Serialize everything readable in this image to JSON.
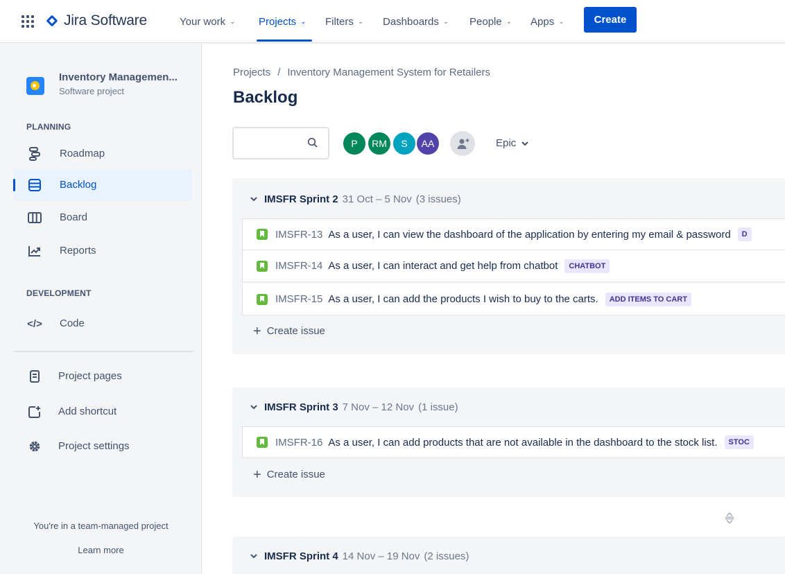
{
  "topnav": {
    "product": "Jira Software",
    "items": [
      {
        "label": "Your work"
      },
      {
        "label": "Projects"
      },
      {
        "label": "Filters"
      },
      {
        "label": "Dashboards"
      },
      {
        "label": "People"
      },
      {
        "label": "Apps"
      }
    ],
    "active_item": "Projects",
    "create_label": "Create",
    "accent": "#0052CC"
  },
  "sidebar": {
    "project_name": "Inventory Managemen...",
    "project_type": "Software project",
    "planning_label": "PLANNING",
    "planning_items": [
      {
        "label": "Roadmap",
        "icon": "roadmap-icon"
      },
      {
        "label": "Backlog",
        "icon": "backlog-icon",
        "active": true
      },
      {
        "label": "Board",
        "icon": "board-icon"
      },
      {
        "label": "Reports",
        "icon": "reports-icon"
      }
    ],
    "development_label": "DEVELOPMENT",
    "development_items": [
      {
        "label": "Code",
        "icon": "code-icon"
      }
    ],
    "other_items": [
      {
        "label": "Project pages",
        "icon": "page-icon"
      },
      {
        "label": "Add shortcut",
        "icon": "add-shortcut-icon"
      },
      {
        "label": "Project settings",
        "icon": "gear-icon"
      }
    ],
    "footer_text": "You're in a team-managed project",
    "footer_link": "Learn more"
  },
  "main": {
    "breadcrumb": [
      "Projects",
      "/",
      "Inventory Management System for Retailers"
    ],
    "title": "Backlog",
    "avatars": [
      {
        "initials": "P",
        "color": "#00875A"
      },
      {
        "initials": "RM",
        "color": "#00875A"
      },
      {
        "initials": "S",
        "color": "#00A3BF"
      },
      {
        "initials": "AA",
        "color": "#5243AA"
      }
    ],
    "epic_filter": "Epic",
    "create_issue_label": "Create issue",
    "sprints": [
      {
        "name": "IMSFR Sprint 2",
        "dates": "31 Oct – 5 Nov",
        "count": "(3 issues)",
        "issues": [
          {
            "key": "IMSFR-13",
            "summary": "As a user, I can view the dashboard of the application by entering my email & password",
            "epic": "D"
          },
          {
            "key": "IMSFR-14",
            "summary": "As a user, I can interact and get help from chatbot",
            "epic": "CHATBOT"
          },
          {
            "key": "IMSFR-15",
            "summary": "As a user, I can add the products I wish to buy to the carts.",
            "epic": "ADD ITEMS TO CART"
          }
        ]
      },
      {
        "name": "IMSFR Sprint 3",
        "dates": "7 Nov – 12 Nov",
        "count": "(1 issue)",
        "issues": [
          {
            "key": "IMSFR-16",
            "summary": "As a user, I can add products that are not available in the dashboard to the stock list.",
            "epic": "STOC"
          }
        ]
      },
      {
        "name": "IMSFR Sprint 4",
        "dates": "14 Nov – 19 Nov",
        "count": "(2 issues)",
        "issues": []
      }
    ]
  }
}
